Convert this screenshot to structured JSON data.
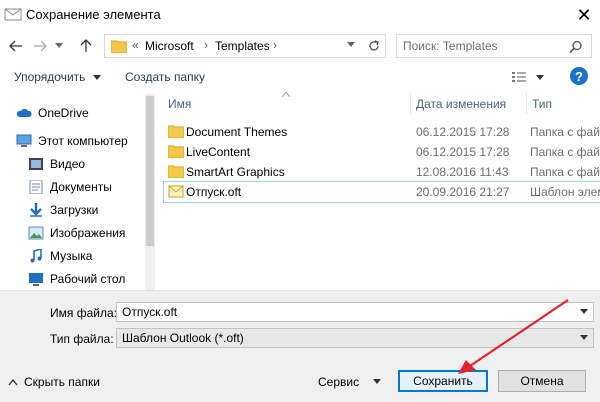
{
  "window": {
    "title": "Сохранение элемента",
    "close_glyph": "✕"
  },
  "address": {
    "prefix": "«",
    "segments": [
      "Microsoft",
      "Templates"
    ],
    "separator": "›"
  },
  "search": {
    "placeholder": "Поиск: Templates"
  },
  "toolbar": {
    "organize": "Упорядочить",
    "new_folder": "Создать папку",
    "help": "?"
  },
  "sidebar": {
    "items": [
      {
        "label": "OneDrive",
        "icon": "cloud-icon"
      },
      {
        "label": "Этот компьютер",
        "icon": "computer-icon"
      },
      {
        "label": "Видео",
        "icon": "video-icon"
      },
      {
        "label": "Документы",
        "icon": "documents-icon"
      },
      {
        "label": "Загрузки",
        "icon": "downloads-icon"
      },
      {
        "label": "Изображения",
        "icon": "pictures-icon"
      },
      {
        "label": "Музыка",
        "icon": "music-icon"
      },
      {
        "label": "Рабочий стол",
        "icon": "desktop-icon"
      }
    ]
  },
  "files": {
    "columns": [
      "Имя",
      "Дата изменения",
      "Тип"
    ],
    "rows": [
      {
        "name": "Document Themes",
        "date": "06.12.2015 17:28",
        "type": "Папка с фай",
        "icon": "folder-icon"
      },
      {
        "name": "LiveContent",
        "date": "06.12.2015 17:28",
        "type": "Папка с фай",
        "icon": "folder-icon"
      },
      {
        "name": "SmartArt Graphics",
        "date": "12.08.2016 11:43",
        "type": "Папка с фай",
        "icon": "folder-icon"
      },
      {
        "name": "Отпуск.oft",
        "date": "20.09.2016 21:27",
        "type": "Шаблон элем",
        "icon": "outlook-template-icon"
      }
    ]
  },
  "form": {
    "filename_label": "Имя файла:",
    "filename_value": "Отпуск.oft",
    "filetype_label": "Тип файла:",
    "filetype_value": "Шаблон Outlook (*.oft)"
  },
  "footer": {
    "hide_folders": "Скрыть папки",
    "service": "Сервис",
    "save": "Сохранить",
    "cancel": "Отмена"
  },
  "colors": {
    "accent": "#0078d7",
    "annotation_arrow": "#e0242a",
    "folder": "#f5c84c"
  }
}
